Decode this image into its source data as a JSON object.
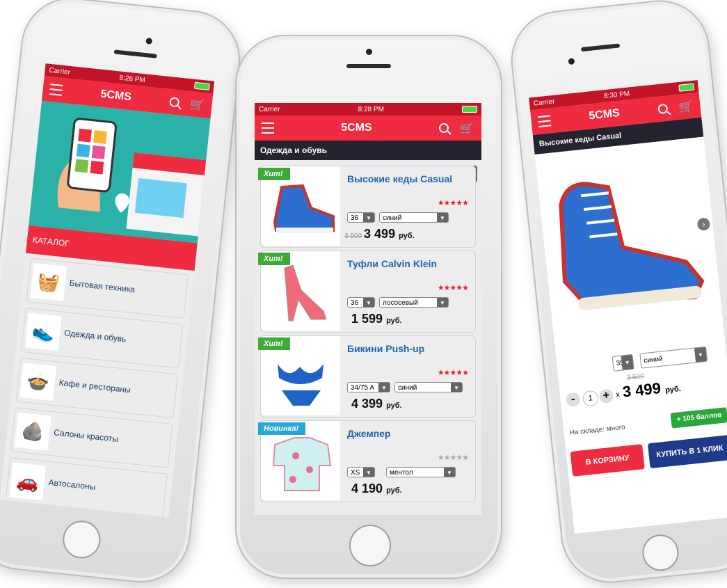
{
  "colors": {
    "brand": "#ef2b40",
    "status": "#c41428",
    "section": "#25232f",
    "link": "#1f63b0",
    "green": "#2aa63a",
    "navy": "#1f3a8a"
  },
  "left": {
    "status": {
      "carrier": "Carrier",
      "time": "8:26 PM"
    },
    "app_title": "5CMS",
    "catalog_label": "КАТАЛОГ",
    "categories": [
      {
        "label": "Бытовая техника",
        "icon": "appliance-icon"
      },
      {
        "label": "Одежда и обувь",
        "icon": "sneaker-icon"
      },
      {
        "label": "Кафе и рестораны",
        "icon": "food-icon"
      },
      {
        "label": "Салоны красоты",
        "icon": "spa-stones-icon"
      },
      {
        "label": "Автосалоны",
        "icon": "car-icon"
      }
    ]
  },
  "center": {
    "status": {
      "carrier": "Carrier",
      "time": "8:28 PM"
    },
    "app_title": "5CMS",
    "section": "Одежда и обувь",
    "products": [
      {
        "tag": "Хит!",
        "name": "Высокие кеды Casual",
        "size": "36",
        "color": "синий",
        "old_price": "3 500",
        "price": "3 499",
        "currency": "руб.",
        "rating": 5
      },
      {
        "tag": "Хит!",
        "name": "Туфли Calvin Klein",
        "size": "36",
        "color": "лососевый",
        "old_price": "",
        "price": "1 599",
        "currency": "руб.",
        "rating": 5
      },
      {
        "tag": "Хит!",
        "name": "Бикини Push-up",
        "size": "34/75 A",
        "color": "синий",
        "old_price": "",
        "price": "4 399",
        "currency": "руб.",
        "rating": 5
      },
      {
        "tag": "Новинка!",
        "name": "Джемпер",
        "size": "XS",
        "color": "ментол",
        "old_price": "",
        "price": "4 190",
        "currency": "руб.",
        "rating": 0
      }
    ]
  },
  "right": {
    "status": {
      "carrier": "Carrier",
      "time": "8:30 PM"
    },
    "app_title": "5CMS",
    "section": "Высокие кеды Casual",
    "size": "35",
    "color": "синий",
    "quantity": "1",
    "minus": "-",
    "plus": "+",
    "times": "x",
    "old_price": "3 500",
    "price": "3 499",
    "currency": "руб.",
    "stock": "На складе: много",
    "bonus": "+ 105 баллов",
    "cart_btn": "В КОРЗИНУ",
    "buy_btn": "КУПИТЬ В 1 КЛИК"
  }
}
